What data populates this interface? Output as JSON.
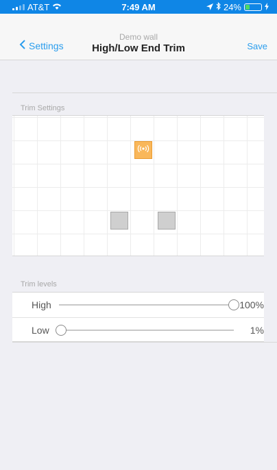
{
  "status_bar": {
    "carrier": "AT&T",
    "time": "7:49 AM",
    "battery": "24%",
    "battery_level": 0.24,
    "icons": [
      "signal-icon",
      "wifi-icon",
      "location-icon",
      "bluetooth-icon",
      "battery-icon",
      "charging-icon"
    ]
  },
  "nav": {
    "back_label": "Settings",
    "subtitle": "Demo wall",
    "title": "High/Low End Trim",
    "save_label": "Save"
  },
  "sections": {
    "trim_settings": "Trim Settings",
    "trim_levels": "Trim levels"
  },
  "trim_levels": {
    "high": {
      "label": "High",
      "value": "100%",
      "level": 1.0
    },
    "low": {
      "label": "Low",
      "value": "1%",
      "level": 0.01
    }
  },
  "colors": {
    "status_bar": "#0f86e6",
    "accent": "#2a9ded",
    "sensor": "#f9b75a",
    "fixture": "#cfcfcf"
  }
}
